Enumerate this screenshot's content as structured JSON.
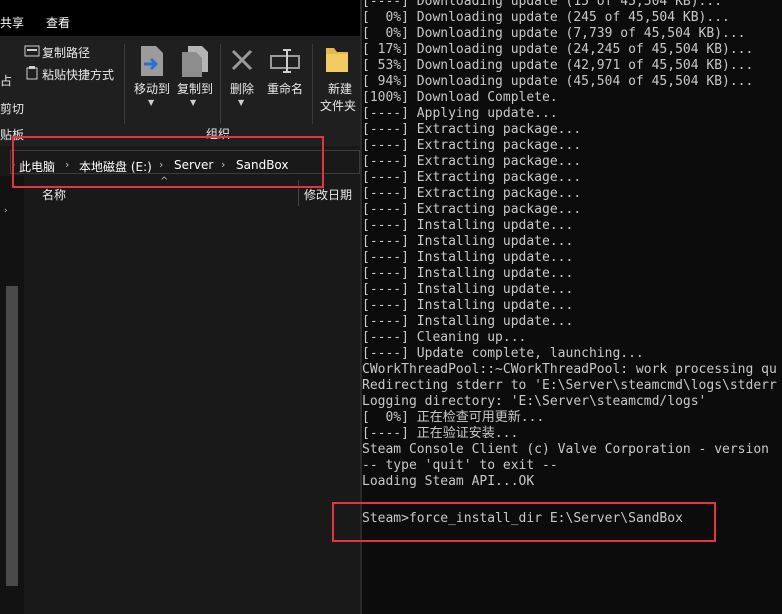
{
  "menubar": {
    "share": "共享",
    "view": "查看"
  },
  "ribbon": {
    "copy_path": "复制路径",
    "paste_shortcut": "粘贴快捷方式",
    "move_to": "移动到",
    "copy_to": "复制到",
    "delete": "删除",
    "rename": "重命名",
    "new_folder_line1": "新建",
    "new_folder_line2": "文件夹",
    "group_organize": "组织",
    "clip_cut_fragment": "剪切",
    "clip_paste_fragment": "占",
    "clipboard_fragment": "贴板"
  },
  "address": {
    "crumbs": [
      "此电脑",
      "本地磁盘 (E:)",
      "Server",
      "SandBox"
    ],
    "separator": "›"
  },
  "columns": {
    "name": "名称",
    "date": "修改日期"
  },
  "console": {
    "lines": [
      "[----] Downloading update (15 of 45,504 KB)...",
      "[  0%] Downloading update (245 of 45,504 KB)...",
      "[  0%] Downloading update (7,739 of 45,504 KB)...",
      "[ 17%] Downloading update (24,245 of 45,504 KB)...",
      "[ 53%] Downloading update (42,971 of 45,504 KB)...",
      "[ 94%] Downloading update (45,504 of 45,504 KB)...",
      "[100%] Download Complete.",
      "[----] Applying update...",
      "[----] Extracting package...",
      "[----] Extracting package...",
      "[----] Extracting package...",
      "[----] Extracting package...",
      "[----] Extracting package...",
      "[----] Extracting package...",
      "[----] Installing update...",
      "[----] Installing update...",
      "[----] Installing update...",
      "[----] Installing update...",
      "[----] Installing update...",
      "[----] Installing update...",
      "[----] Installing update...",
      "[----] Cleaning up...",
      "[----] Update complete, launching...",
      "CWorkThreadPool::~CWorkThreadPool: work processing qu",
      "Redirecting stderr to 'E:\\Server\\steamcmd\\logs\\stderr",
      "Logging directory: 'E:\\Server\\steamcmd/logs'",
      "[  0%] 正在检查可用更新...",
      "[----] 正在验证安装...",
      "Steam Console Client (c) Valve Corporation - version",
      "-- type 'quit' to exit --",
      "Loading Steam API...OK"
    ],
    "prompt": "Steam>",
    "command": "force_install_dir E:\\Server\\SandBox"
  },
  "colors": {
    "highlight": "#e5343c",
    "console_bg": "#0c0c0c",
    "explorer_bg": "#191919"
  }
}
